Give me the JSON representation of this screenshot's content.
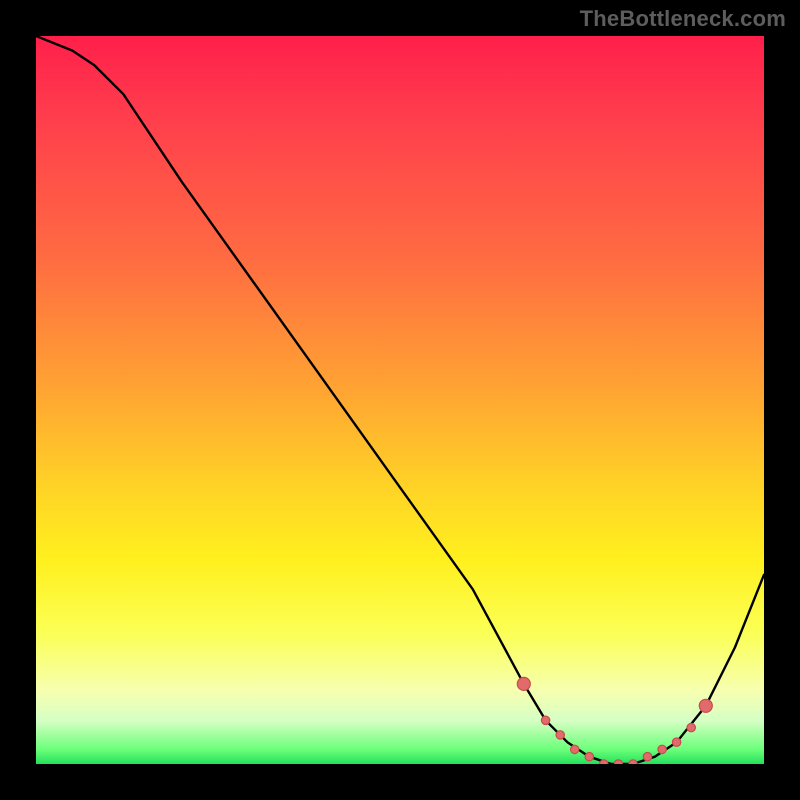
{
  "watermark": "TheBottleneck.com",
  "chart_data": {
    "type": "line",
    "title": "",
    "xlabel": "",
    "ylabel": "",
    "xlim": [
      0,
      100
    ],
    "ylim": [
      0,
      100
    ],
    "grid": false,
    "background_gradient": {
      "top": "#ff1f4a",
      "bottom": "#22e05c",
      "meaning": "high (red) to optimal (green) bottleneck severity"
    },
    "series": [
      {
        "name": "bottleneck-curve",
        "color": "#000000",
        "x": [
          0,
          5,
          8,
          12,
          20,
          30,
          40,
          50,
          60,
          67,
          70,
          73,
          76,
          79,
          82,
          85,
          88,
          92,
          96,
          100
        ],
        "values": [
          100,
          98,
          96,
          92,
          80,
          66,
          52,
          38,
          24,
          11,
          6,
          3,
          1,
          0,
          0,
          1,
          3,
          8,
          16,
          26
        ]
      }
    ],
    "markers": {
      "name": "highlighted-points",
      "color": "#e36a6a",
      "stroke": "#c74d4d",
      "x": [
        67,
        70,
        72,
        74,
        76,
        78,
        80,
        82,
        84,
        86,
        88,
        90,
        92
      ],
      "values": [
        11,
        6,
        4,
        2,
        1,
        0,
        0,
        0,
        1,
        2,
        3,
        5,
        8
      ]
    }
  }
}
